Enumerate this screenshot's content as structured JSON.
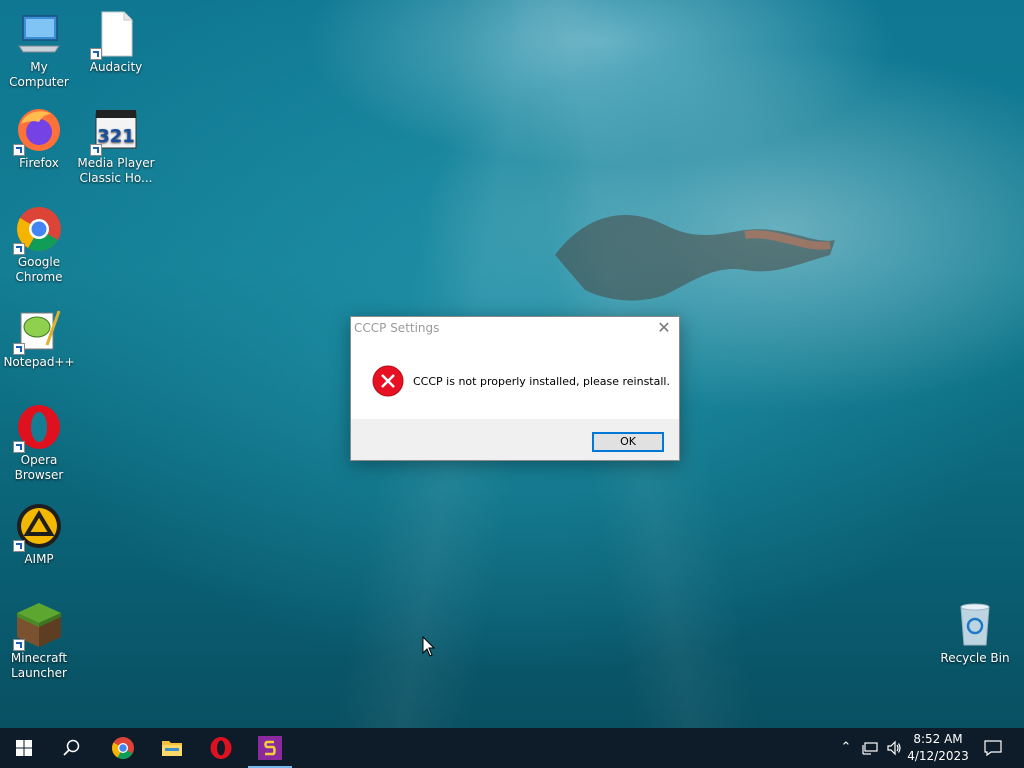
{
  "desktop": {
    "icons": [
      {
        "label": "My Computer",
        "icon": "computer-icon"
      },
      {
        "label": "Audacity",
        "icon": "file-icon"
      },
      {
        "label": "Firefox",
        "icon": "firefox-icon"
      },
      {
        "label": "Media Player Classic Ho...",
        "icon": "mpc-icon"
      },
      {
        "label": "Google Chrome",
        "icon": "chrome-icon"
      },
      {
        "label": "Notepad++",
        "icon": "notepadpp-icon"
      },
      {
        "label": "Opera Browser",
        "icon": "opera-icon"
      },
      {
        "label": "AIMP",
        "icon": "aimp-icon"
      },
      {
        "label": "Minecraft Launcher",
        "icon": "minecraft-icon"
      },
      {
        "label": "Recycle Bin",
        "icon": "recycle-bin-icon"
      }
    ]
  },
  "dialog": {
    "title": "CCCP Settings",
    "message": "CCCP is not properly installed, please reinstall.",
    "ok_label": "OK",
    "close_symbol": "✕",
    "icon": "error-icon"
  },
  "taskbar": {
    "apps": [
      "start-icon",
      "search-icon",
      "chrome-icon",
      "file-explorer-icon",
      "opera-icon",
      "app-s-icon"
    ],
    "active_app": "app-s-icon",
    "tray": [
      "chevron-up-icon",
      "network-icon",
      "volume-icon"
    ],
    "clock": {
      "time": "8:52 AM",
      "date": "4/12/2023"
    },
    "notification_icon": "notification-icon"
  },
  "colors": {
    "accent": "#0078d7",
    "taskbar": "#0e1c2a",
    "error_red": "#e81123"
  }
}
